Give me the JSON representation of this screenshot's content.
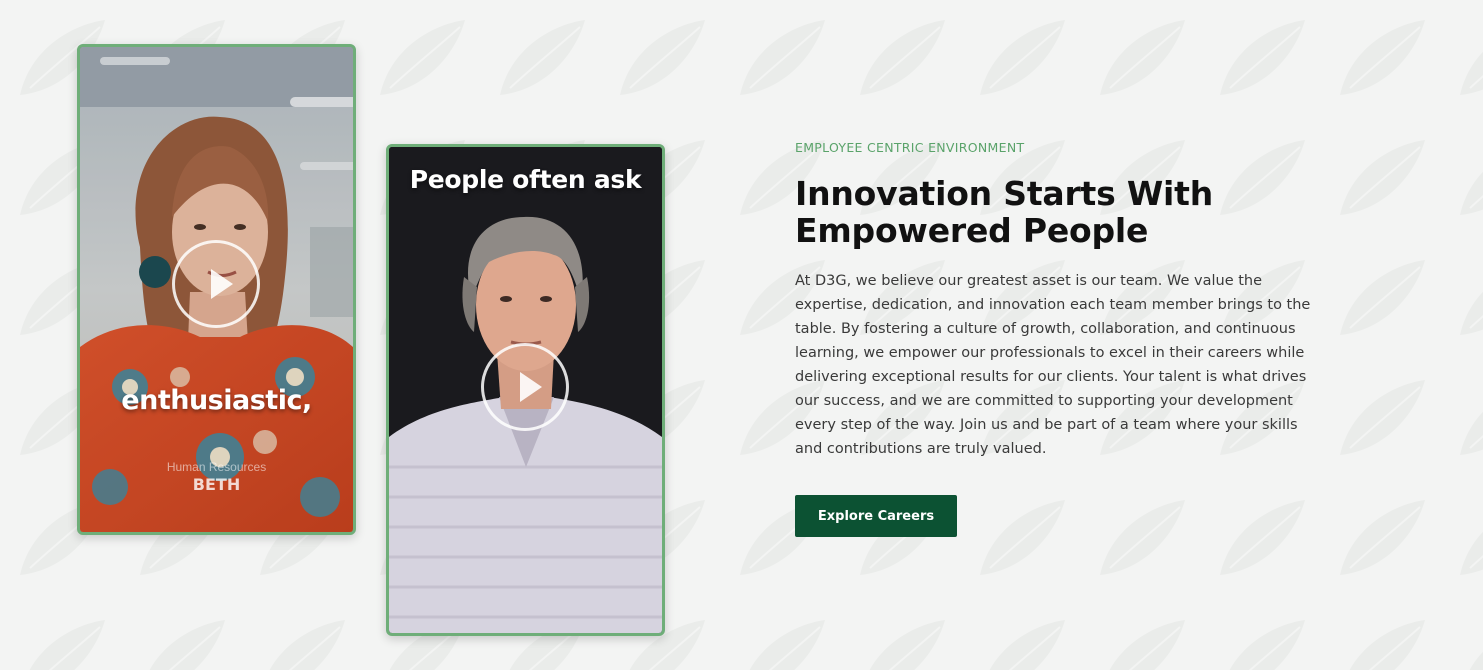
{
  "colors": {
    "accent_green": "#5aa36a",
    "button_green": "#0c5233",
    "card_border": "#6fae79",
    "background": "#f3f4f3"
  },
  "videos": [
    {
      "caption": "enthusiastic,",
      "role": "Human Resources",
      "name": "BETH",
      "icon": "play-icon"
    },
    {
      "caption": "People often ask",
      "icon": "play-icon"
    }
  ],
  "section": {
    "eyebrow": "EMPLOYEE CENTRIC ENVIRONMENT",
    "headline_line1": "Innovation Starts With",
    "headline_line2": "Empowered People",
    "body": "At D3G, we believe our greatest asset is our team. We value the expertise, dedication, and innovation each team member brings to the table. By fostering a culture of growth, collaboration, and continuous learning, we empower our professionals to excel in their careers while delivering exceptional results for our clients. Your talent is what drives our success, and we are committed to supporting your development every step of the way. Join us and be part of a team where your skills and contributions are truly valued.",
    "cta_label": "Explore Careers"
  }
}
